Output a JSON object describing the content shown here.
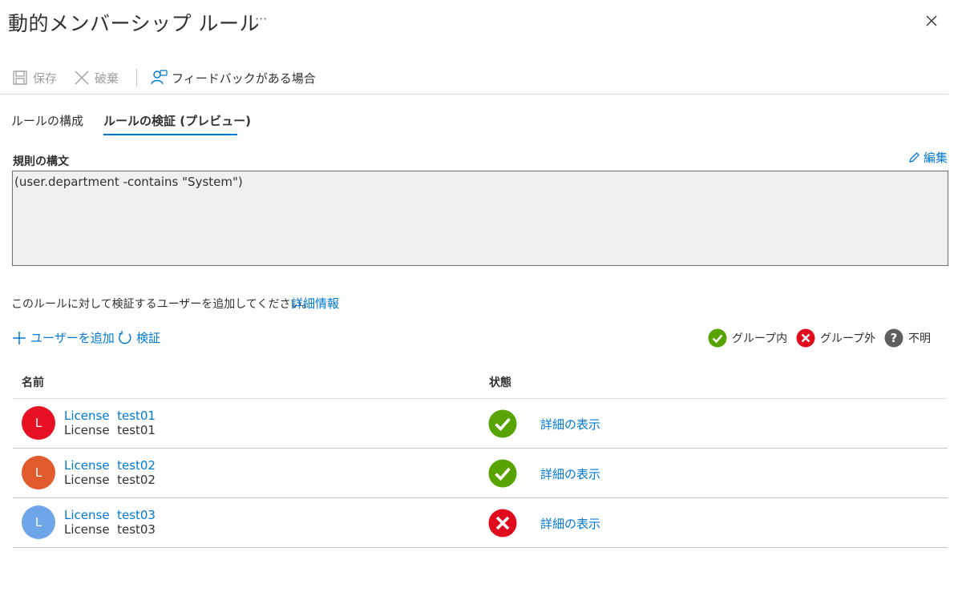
{
  "header": {
    "title": "動的メンバーシップ ルール",
    "more": "···"
  },
  "toolbar": {
    "save_label": "保存",
    "discard_label": "破棄",
    "feedback_label": "フィードバックがある場合"
  },
  "tabs": [
    {
      "label": "ルールの構成",
      "active": false
    },
    {
      "label": "ルールの検証 (プレビュー)",
      "active": true
    }
  ],
  "rule": {
    "section_label": "規則の構文",
    "edit_label": "編集",
    "syntax": "(user.department -contains \"System\")"
  },
  "help": {
    "text": "このルールに対して検証するユーザーを追加してください。",
    "link": "詳細情報"
  },
  "actions": {
    "add_user_label": "ユーザーを追加",
    "validate_label": "検証"
  },
  "legend": {
    "in_group": "グループ内",
    "out_group": "グループ外",
    "unknown": "不明"
  },
  "table": {
    "columns": {
      "name": "名前",
      "status": "状態"
    },
    "rows": [
      {
        "initial": "L",
        "avatar_color": "#e81123",
        "display_name": "License  test01",
        "sub_name": "License  test01",
        "status": "in",
        "detail_label": "詳細の表示"
      },
      {
        "initial": "L",
        "avatar_color": "#e05a2b",
        "display_name": "License  test02",
        "sub_name": "License  test02",
        "status": "in",
        "detail_label": "詳細の表示"
      },
      {
        "initial": "L",
        "avatar_color": "#6fa6e8",
        "display_name": "License  test03",
        "sub_name": "License  test03",
        "status": "out",
        "detail_label": "詳細の表示"
      }
    ]
  },
  "colors": {
    "accent": "#0078d4",
    "success": "#57a300",
    "error": "#e00b1c",
    "unknown": "#605e5c"
  }
}
